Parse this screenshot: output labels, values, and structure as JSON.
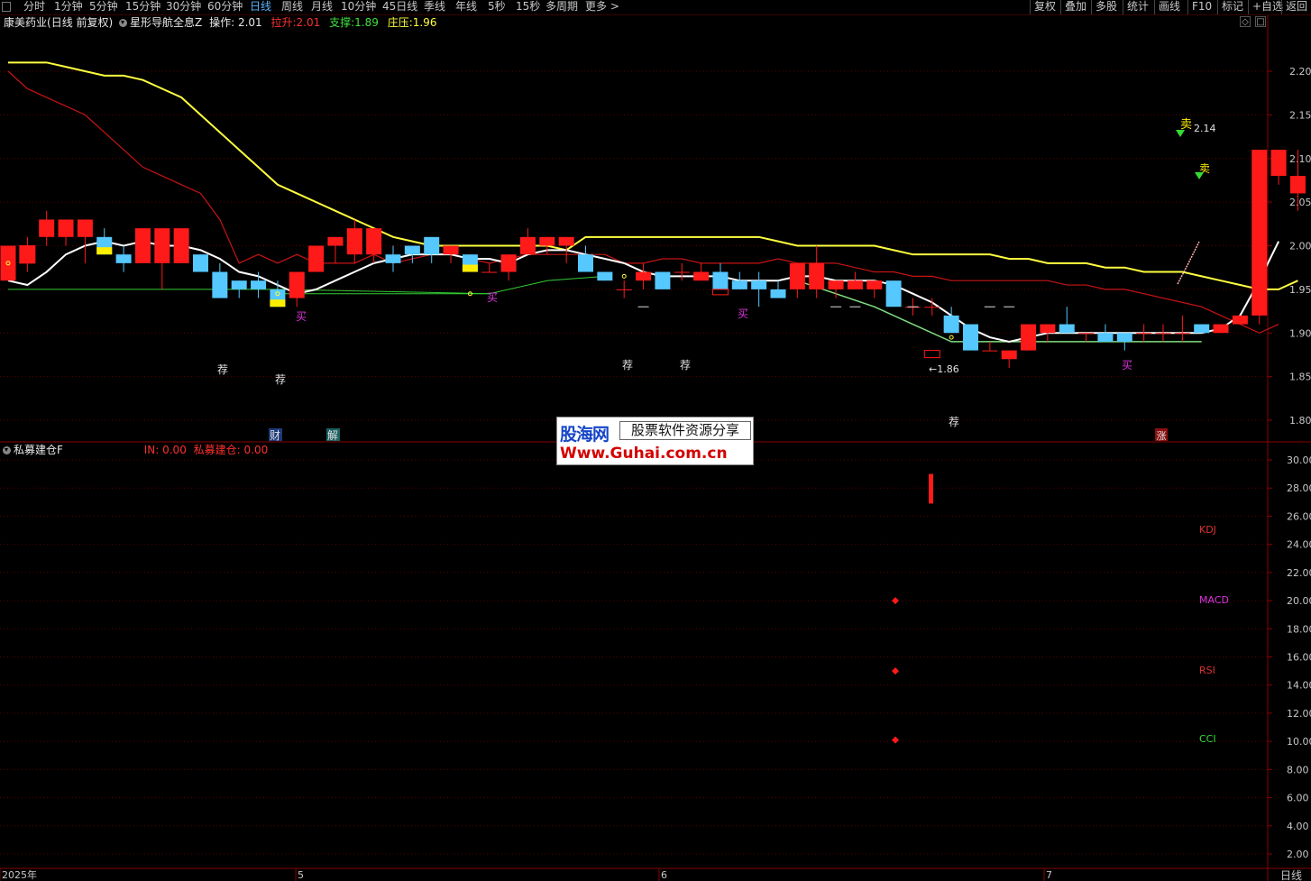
{
  "topbar": {
    "periods": [
      "分时",
      "1分钟",
      "5分钟",
      "15分钟",
      "30分钟",
      "60分钟",
      "日线",
      "周线",
      "月线",
      "10分钟",
      "45日线",
      "季线",
      "年线",
      "5秒",
      "15秒",
      "多周期",
      "更多 >"
    ],
    "active_period": "日线",
    "right_buttons": [
      "复权",
      "叠加",
      "多股",
      "统计",
      "画线",
      "F10",
      "标记",
      "+自选",
      "返回"
    ]
  },
  "info": {
    "stock_name": "康美药业",
    "mode": "(日线 前复权)",
    "indicator": "星形导航全息Z",
    "op_label": "操作: 2.01",
    "lift_label": "拉升: ",
    "lift_value": "2.01",
    "support_label": "支撑: ",
    "support_value": "1.89",
    "zhuang_label": "庄压: ",
    "zhuang_value": "1.96"
  },
  "sub_indicator": {
    "name": "私募建仓F",
    "in_label": "IN: 0.00",
    "pos_label": "私募建仓: 0.00",
    "kdj": "KDJ",
    "macd": "MACD",
    "rsi": "RSI",
    "cci": "CCI"
  },
  "watermark": {
    "logo": "股海网",
    "slogan": "股票软件资源分享",
    "url": "Www.Guhai.com.cn"
  },
  "main_axis_labels": [
    "2.20",
    "2.15",
    "2.10",
    "2.05",
    "2.00",
    "1.95",
    "1.90",
    "1.85",
    "1.80"
  ],
  "sub_axis_labels": [
    "30.00",
    "28.00",
    "26.00",
    "24.00",
    "22.00",
    "20.00",
    "18.00",
    "16.00",
    "14.00",
    "12.00",
    "10.00",
    "8.00",
    "6.00",
    "4.00",
    "2.00"
  ],
  "x_labels": [
    "2025年",
    "5",
    "6",
    "7"
  ],
  "bottom_right_label": "日线",
  "annotations": {
    "high_label": "2.14",
    "low_label": "←1.86",
    "sell": "卖",
    "buy": "买",
    "recommend": "荐",
    "cai": "财",
    "jie": "解",
    "zhang": "涨"
  },
  "colors": {
    "up": "#ff1a1a",
    "down": "#55c8ff",
    "yellow_line": "#ffff40",
    "red_line": "#c81414",
    "white_line": "#ffffff",
    "green_line": "#33cc33",
    "grid": "#5a0000"
  },
  "chart_data": {
    "type": "candlestick",
    "ylim": [
      1.78,
      2.23
    ],
    "candles": [
      {
        "o": 1.96,
        "h": 1.98,
        "l": 1.96,
        "c": 2.0
      },
      {
        "o": 1.98,
        "h": 2.01,
        "l": 1.97,
        "c": 2.0
      },
      {
        "o": 2.01,
        "h": 2.04,
        "l": 2.0,
        "c": 2.03
      },
      {
        "o": 2.01,
        "h": 2.03,
        "l": 2.0,
        "c": 2.03
      },
      {
        "o": 2.01,
        "h": 2.03,
        "l": 1.98,
        "c": 2.03
      },
      {
        "o": 2.01,
        "h": 2.02,
        "l": 1.99,
        "c": 1.99
      },
      {
        "o": 1.99,
        "h": 2.0,
        "l": 1.97,
        "c": 1.98
      },
      {
        "o": 1.98,
        "h": 2.02,
        "l": 1.98,
        "c": 2.02
      },
      {
        "o": 1.98,
        "h": 2.02,
        "l": 1.95,
        "c": 2.02
      },
      {
        "o": 1.98,
        "h": 2.02,
        "l": 1.98,
        "c": 2.02
      },
      {
        "o": 1.99,
        "h": 1.99,
        "l": 1.97,
        "c": 1.97
      },
      {
        "o": 1.97,
        "h": 1.98,
        "l": 1.94,
        "c": 1.94
      },
      {
        "o": 1.96,
        "h": 1.96,
        "l": 1.94,
        "c": 1.95
      },
      {
        "o": 1.96,
        "h": 1.97,
        "l": 1.94,
        "c": 1.95
      },
      {
        "o": 1.95,
        "h": 1.96,
        "l": 1.93,
        "c": 1.93
      },
      {
        "o": 1.94,
        "h": 1.97,
        "l": 1.93,
        "c": 1.97
      },
      {
        "o": 1.97,
        "h": 2.0,
        "l": 1.97,
        "c": 2.0
      },
      {
        "o": 2.0,
        "h": 2.01,
        "l": 1.98,
        "c": 2.01
      },
      {
        "o": 1.99,
        "h": 2.03,
        "l": 1.98,
        "c": 2.02
      },
      {
        "o": 1.99,
        "h": 2.02,
        "l": 1.98,
        "c": 2.02
      },
      {
        "o": 1.99,
        "h": 2.0,
        "l": 1.97,
        "c": 1.98
      },
      {
        "o": 2.0,
        "h": 2.0,
        "l": 1.98,
        "c": 1.99
      },
      {
        "o": 2.01,
        "h": 2.01,
        "l": 1.98,
        "c": 1.99
      },
      {
        "o": 1.99,
        "h": 2.0,
        "l": 1.98,
        "c": 2.0
      },
      {
        "o": 1.99,
        "h": 1.99,
        "l": 1.97,
        "c": 1.97
      },
      {
        "o": 1.97,
        "h": 1.98,
        "l": 1.97,
        "c": 1.97
      },
      {
        "o": 1.97,
        "h": 1.99,
        "l": 1.96,
        "c": 1.99
      },
      {
        "o": 1.99,
        "h": 2.02,
        "l": 1.99,
        "c": 2.01
      },
      {
        "o": 2.0,
        "h": 2.01,
        "l": 1.99,
        "c": 2.01
      },
      {
        "o": 2.0,
        "h": 2.01,
        "l": 1.98,
        "c": 2.01
      },
      {
        "o": 1.99,
        "h": 2.0,
        "l": 1.97,
        "c": 1.97
      },
      {
        "o": 1.97,
        "h": 1.97,
        "l": 1.96,
        "c": 1.96
      },
      {
        "o": 1.95,
        "h": 1.96,
        "l": 1.94,
        "c": 1.95
      },
      {
        "o": 1.96,
        "h": 1.98,
        "l": 1.95,
        "c": 1.97
      },
      {
        "o": 1.97,
        "h": 1.97,
        "l": 1.95,
        "c": 1.95
      },
      {
        "o": 1.97,
        "h": 1.98,
        "l": 1.96,
        "c": 1.97
      },
      {
        "o": 1.96,
        "h": 1.98,
        "l": 1.96,
        "c": 1.97
      },
      {
        "o": 1.97,
        "h": 1.98,
        "l": 1.95,
        "c": 1.95
      },
      {
        "o": 1.96,
        "h": 1.97,
        "l": 1.95,
        "c": 1.95
      },
      {
        "o": 1.96,
        "h": 1.97,
        "l": 1.93,
        "c": 1.95
      },
      {
        "o": 1.95,
        "h": 1.96,
        "l": 1.94,
        "c": 1.94
      },
      {
        "o": 1.95,
        "h": 1.98,
        "l": 1.94,
        "c": 1.98
      },
      {
        "o": 1.95,
        "h": 2.0,
        "l": 1.94,
        "c": 1.98
      },
      {
        "o": 1.95,
        "h": 1.96,
        "l": 1.94,
        "c": 1.96
      },
      {
        "o": 1.95,
        "h": 1.97,
        "l": 1.95,
        "c": 1.96
      },
      {
        "o": 1.95,
        "h": 1.96,
        "l": 1.94,
        "c": 1.96
      },
      {
        "o": 1.96,
        "h": 1.96,
        "l": 1.93,
        "c": 1.93
      },
      {
        "o": 1.93,
        "h": 1.94,
        "l": 1.92,
        "c": 1.93
      },
      {
        "o": 1.93,
        "h": 1.94,
        "l": 1.92,
        "c": 1.93
      },
      {
        "o": 1.92,
        "h": 1.93,
        "l": 1.9,
        "c": 1.9
      },
      {
        "o": 1.91,
        "h": 1.91,
        "l": 1.88,
        "c": 1.88
      },
      {
        "o": 1.88,
        "h": 1.89,
        "l": 1.88,
        "c": 1.88
      },
      {
        "o": 1.87,
        "h": 1.88,
        "l": 1.86,
        "c": 1.88
      },
      {
        "o": 1.88,
        "h": 1.91,
        "l": 1.88,
        "c": 1.91
      },
      {
        "o": 1.9,
        "h": 1.91,
        "l": 1.89,
        "c": 1.91
      },
      {
        "o": 1.91,
        "h": 1.93,
        "l": 1.9,
        "c": 1.9
      },
      {
        "o": 1.9,
        "h": 1.9,
        "l": 1.89,
        "c": 1.9
      },
      {
        "o": 1.9,
        "h": 1.91,
        "l": 1.89,
        "c": 1.89
      },
      {
        "o": 1.9,
        "h": 1.9,
        "l": 1.88,
        "c": 1.89
      },
      {
        "o": 1.9,
        "h": 1.91,
        "l": 1.89,
        "c": 1.9
      },
      {
        "o": 1.9,
        "h": 1.91,
        "l": 1.89,
        "c": 1.9
      },
      {
        "o": 1.9,
        "h": 1.92,
        "l": 1.89,
        "c": 1.9
      },
      {
        "o": 1.91,
        "h": 1.91,
        "l": 1.9,
        "c": 1.9
      },
      {
        "o": 1.9,
        "h": 1.91,
        "l": 1.9,
        "c": 1.91
      },
      {
        "o": 1.91,
        "h": 1.92,
        "l": 1.91,
        "c": 1.92
      },
      {
        "o": 1.92,
        "h": 2.11,
        "l": 1.91,
        "c": 2.11
      },
      {
        "o": 2.08,
        "h": 2.11,
        "l": 2.07,
        "c": 2.11
      },
      {
        "o": 2.06,
        "h": 2.11,
        "l": 2.04,
        "c": 2.08
      }
    ],
    "yellow_ma": [
      2.21,
      2.21,
      2.21,
      2.205,
      2.2,
      2.195,
      2.195,
      2.19,
      2.18,
      2.17,
      2.15,
      2.13,
      2.11,
      2.09,
      2.07,
      2.06,
      2.05,
      2.04,
      2.03,
      2.02,
      2.01,
      2.005,
      2.0,
      2.0,
      2.0,
      2.0,
      2.0,
      2.0,
      2.0,
      1.995,
      2.01,
      2.01,
      2.01,
      2.01,
      2.01,
      2.01,
      2.01,
      2.01,
      2.01,
      2.01,
      2.005,
      2.0,
      2.0,
      2.0,
      2.0,
      2.0,
      1.995,
      1.99,
      1.99,
      1.99,
      1.99,
      1.99,
      1.985,
      1.985,
      1.98,
      1.98,
      1.98,
      1.975,
      1.975,
      1.97,
      1.97,
      1.97,
      1.965,
      1.96,
      1.955,
      1.95,
      1.95,
      1.96
    ],
    "red_ma": [
      2.2,
      2.18,
      2.17,
      2.16,
      2.15,
      2.13,
      2.11,
      2.09,
      2.08,
      2.07,
      2.06,
      2.03,
      1.98,
      1.99,
      1.98,
      1.99,
      1.98,
      1.98,
      1.98,
      1.99,
      1.98,
      1.985,
      1.99,
      1.99,
      1.985,
      1.98,
      1.985,
      1.99,
      1.99,
      1.99,
      1.99,
      1.99,
      1.98,
      1.98,
      1.985,
      1.985,
      1.98,
      1.98,
      1.98,
      1.98,
      1.985,
      1.98,
      1.98,
      1.98,
      1.975,
      1.97,
      1.97,
      1.965,
      1.965,
      1.96,
      1.96,
      1.96,
      1.96,
      1.96,
      1.96,
      1.955,
      1.955,
      1.95,
      1.95,
      1.945,
      1.94,
      1.935,
      1.93,
      1.92,
      1.91,
      1.9,
      1.91
    ],
    "sub_points": [
      {
        "x_index": 46,
        "y": 20.0
      },
      {
        "x_index": 46,
        "y": 15.0
      },
      {
        "x_index": 46,
        "y": 10.1
      }
    ],
    "sub_bar": {
      "x_index": 48,
      "y_from": 26.9,
      "y_to": 29.0
    }
  }
}
